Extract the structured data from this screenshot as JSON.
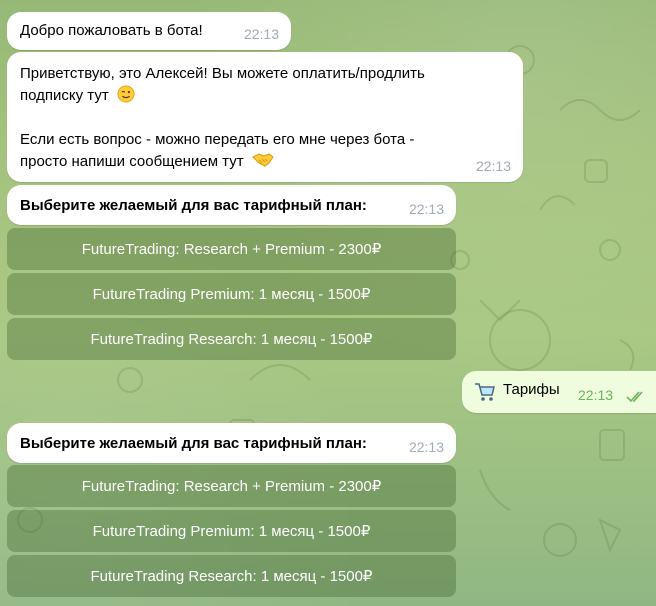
{
  "messages": [
    {
      "text": "Добро пожаловать в бота!",
      "time": "22:13"
    },
    {
      "lines": [
        "Приветствую, это Алексей! Вы можете оплатить/продлить",
        "подписку тут",
        "Если есть вопрос - можно передать его мне через бота -",
        "просто напиши сообщением тут"
      ],
      "emojis": [
        "winking-face",
        "handshake"
      ],
      "time": "22:13"
    },
    {
      "text": "Выберите желаемый для вас тарифный план:",
      "time": "22:13",
      "buttons": [
        "FutureTrading: Research + Premium - 2300₽",
        "FutureTrading Premium: 1 месяц - 1500₽",
        "FutureTrading Research: 1 месяц - 1500₽"
      ]
    },
    {
      "text": "Выберите желаемый для вас тарифный план:",
      "time": "22:13",
      "buttons": [
        "FutureTrading: Research + Premium - 2300₽",
        "FutureTrading Premium: 1 месяц - 1500₽",
        "FutureTrading Research: 1 месяц - 1500₽"
      ]
    }
  ],
  "outgoing": {
    "icon": "shopping-cart-icon",
    "text": "Тарифы",
    "time": "22:13",
    "status": "read-double-check"
  },
  "colors": {
    "background": "#a5c37e",
    "incoming_bubble": "#ffffff",
    "outgoing_bubble": "#effdde",
    "keyboard_button": "#5f8a4a",
    "timestamp": "#a0acb6",
    "outgoing_timestamp": "#6cb25a"
  }
}
